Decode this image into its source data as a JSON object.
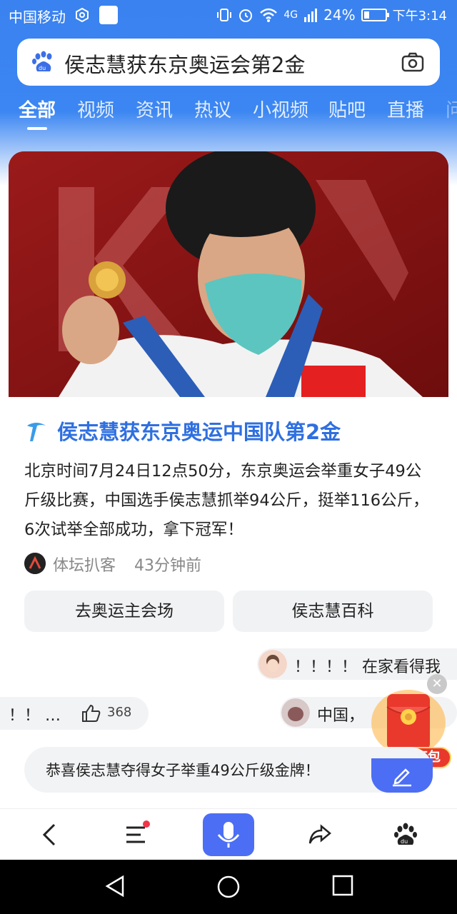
{
  "status_bar": {
    "carrier": "中国移动",
    "network": "4G",
    "battery": "24%",
    "battery_level": 0.24,
    "time": "下午3:14"
  },
  "search": {
    "query": "侯志慧获东京奥运会第2金"
  },
  "tabs": [
    "全部",
    "视频",
    "资讯",
    "热议",
    "小视频",
    "贴吧",
    "直播",
    "问"
  ],
  "active_tab": "全部",
  "card": {
    "title": "侯志慧获东京奥运中国队第2金",
    "description": "北京时间7月24日12点50分，东京奥运会举重女子49公斤级比赛，中国选手侯志慧抓举94公斤，挺举116公斤，6次试举全部成功，拿下冠军！",
    "source_name": "体坛扒客",
    "source_time": "43分钟前",
    "chip_left": "去奥运主会场",
    "chip_right": "侯志慧百科"
  },
  "danmaku": {
    "top_text": "！！！！ 在家看得我",
    "mid_prefix": "！！ …",
    "mid_right_text": "中国，",
    "like_count": "368"
  },
  "red_packet_label": "领现金红包",
  "comment_text": "恭喜侯志慧夺得女子举重49公斤级金牌！",
  "colors": {
    "brand_blue": "#3a82f0",
    "title_blue": "#2f6fe0",
    "mic_blue": "#4c6ef5",
    "red_packet": "#e9392d"
  }
}
